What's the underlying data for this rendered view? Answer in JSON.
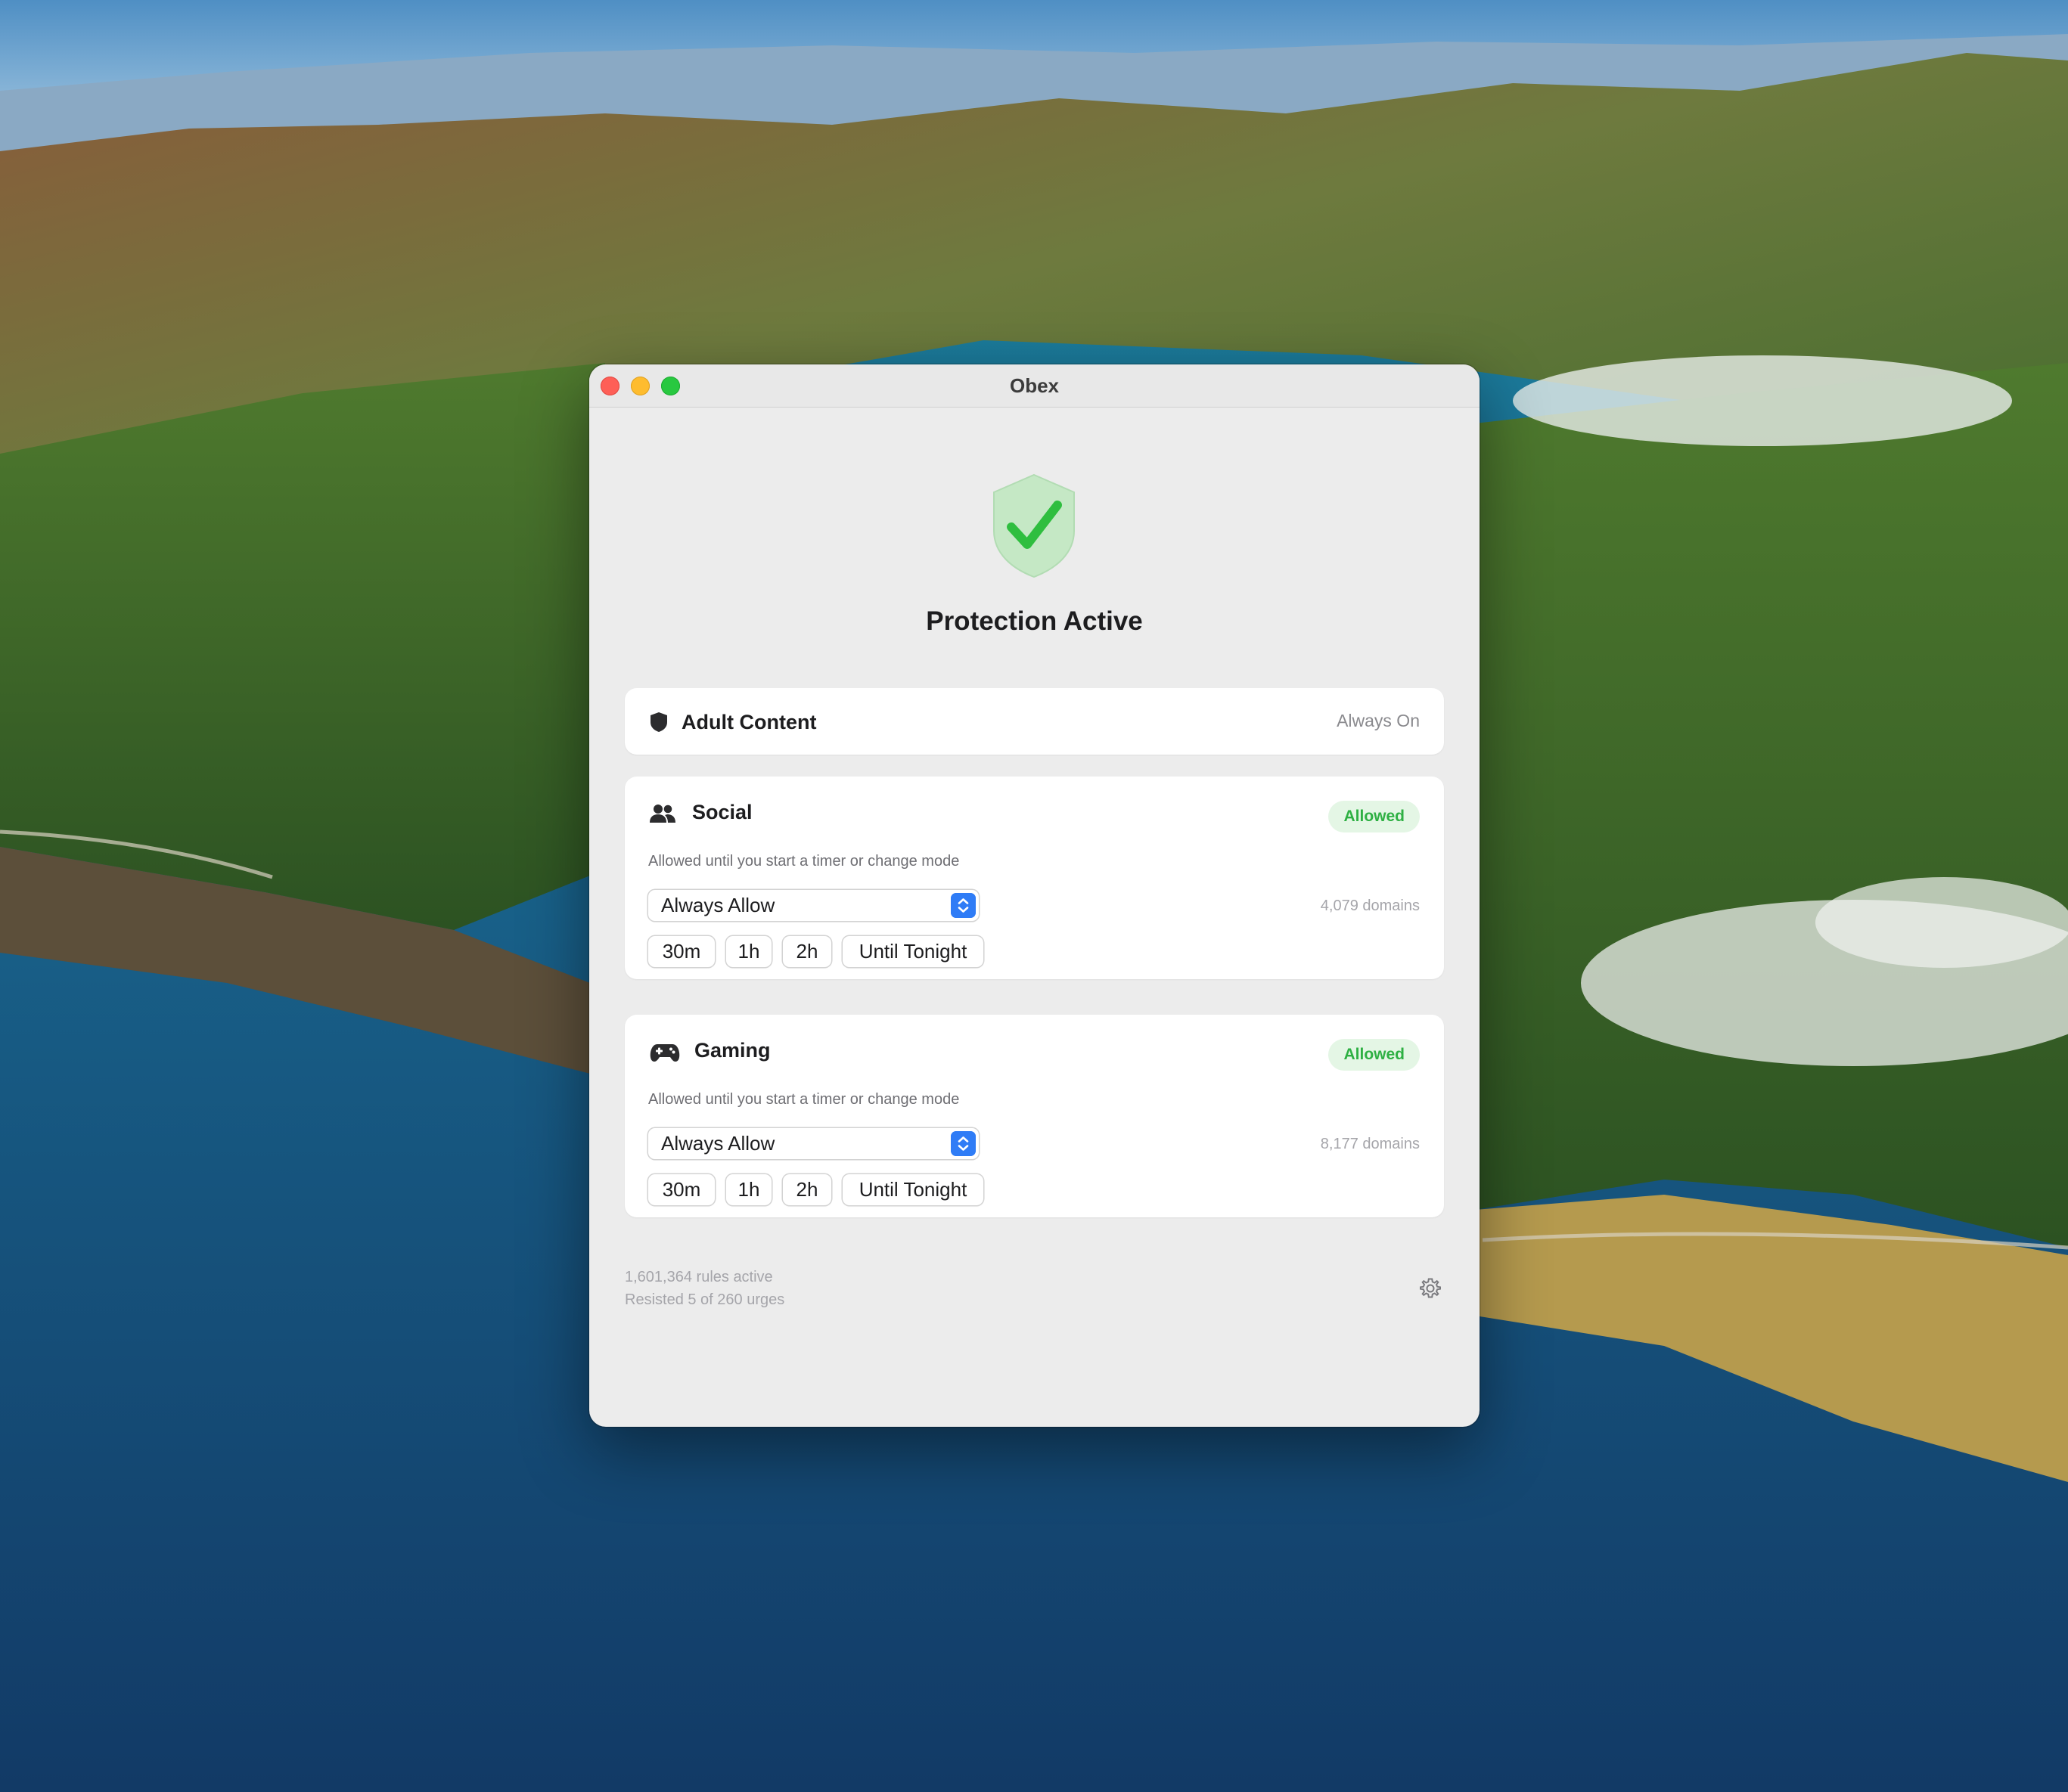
{
  "window": {
    "title": "Obex"
  },
  "status": {
    "title": "Protection Active",
    "icon": "shield-check-icon",
    "color": "#34c759"
  },
  "adult_content": {
    "title": "Adult Content",
    "icon": "shield-icon",
    "state": "Always On"
  },
  "categories": [
    {
      "title": "Social",
      "icon": "people-icon",
      "badge": "Allowed",
      "subtitle": "Allowed until you start a timer or change mode",
      "mode": "Always Allow",
      "domains": "4,079 domains",
      "timers": [
        "30m",
        "1h",
        "2h",
        "Until Tonight"
      ]
    },
    {
      "title": "Gaming",
      "icon": "gamepad-icon",
      "badge": "Allowed",
      "subtitle": "Allowed until you start a timer or change mode",
      "mode": "Always Allow",
      "domains": "8,177 domains",
      "timers": [
        "30m",
        "1h",
        "2h",
        "Until Tonight"
      ]
    }
  ],
  "footer": {
    "rules": "1,601,364 rules active",
    "urges": "Resisted 5 of 260 urges",
    "settings_icon": "gear-icon"
  },
  "colors": {
    "accent": "#2f7cf6",
    "allowed_text": "#2eb043",
    "allowed_bg": "#e4f6e5"
  }
}
